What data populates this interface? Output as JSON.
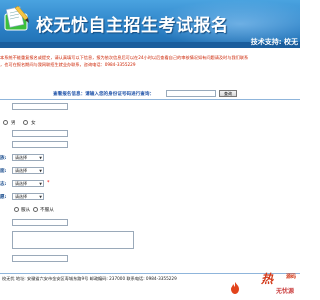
{
  "header": {
    "title": "校无忧自主招生考试报名",
    "tech_support": "技术支持: 校无"
  },
  "notice": {
    "lines": [
      "本系统不能重复报名或提交，请认真填写以下信息，报为依次信息后可以在24小时以后查看自己的审核情况如有问题请及时与我们联系",
      "，也可在报名期间与我网联招生就业办联系，咨询电话：0984-3355229"
    ]
  },
  "query": {
    "label": "查看报名信息：请输入您的身份证号码进行查询：",
    "button_label": "查询"
  },
  "form": {
    "gender": {
      "male": "男",
      "female": "女"
    },
    "select_placeholder": "请选择",
    "obey": {
      "yes": "服从",
      "no": "不服从"
    },
    "required_mark": "*"
  },
  "footer": {
    "text": "校无忧  地址: 安徽省六安市金安区寿城东路9号  邮政编码: 237000  联系电话: 0984-3355229"
  },
  "watermark": {
    "main": "热",
    "sub": "源码",
    "site": "无忧源"
  },
  "colors": {
    "header_blue": "#2a7fc4",
    "notice_red": "#cc2200",
    "label_blue": "#1d4f8f",
    "watermark_red": "#d23a1a"
  }
}
